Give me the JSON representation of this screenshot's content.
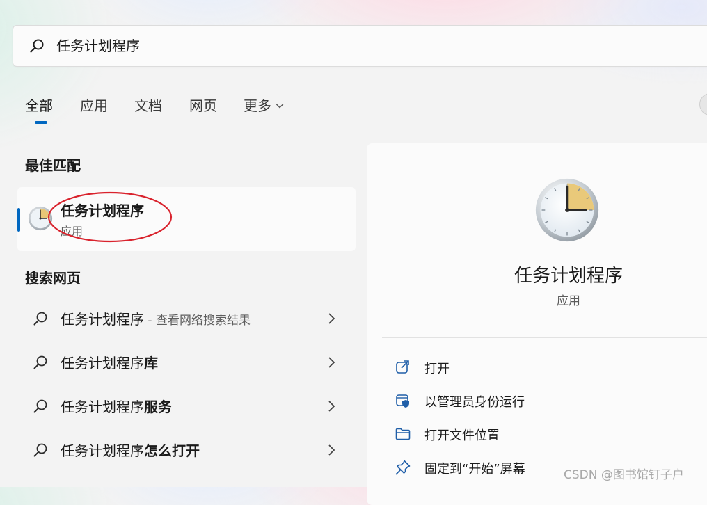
{
  "search": {
    "value": "任务计划程序"
  },
  "tabs": [
    {
      "label": "全部",
      "active": true
    },
    {
      "label": "应用"
    },
    {
      "label": "文档"
    },
    {
      "label": "网页"
    },
    {
      "label": "更多"
    }
  ],
  "best_match": {
    "heading": "最佳匹配",
    "title": "任务计划程序",
    "subtitle": "应用",
    "icon": "task-scheduler-clock-icon"
  },
  "web_search": {
    "heading": "搜索网页",
    "items": [
      {
        "prefix": "任务计划程序",
        "bold": "",
        "hint": " - 查看网络搜索结果"
      },
      {
        "prefix": "任务计划程序",
        "bold": "库",
        "hint": ""
      },
      {
        "prefix": "任务计划程序",
        "bold": "服务",
        "hint": ""
      },
      {
        "prefix": "任务计划程序",
        "bold": "怎么打开",
        "hint": ""
      }
    ]
  },
  "detail": {
    "name": "任务计划程序",
    "type": "应用",
    "actions": [
      {
        "label": "打开",
        "icon": "open-external-icon"
      },
      {
        "label": "以管理员身份运行",
        "icon": "admin-shield-icon"
      },
      {
        "label": "打开文件位置",
        "icon": "folder-icon"
      },
      {
        "label": "固定到“开始”屏幕",
        "icon": "pin-icon"
      }
    ]
  },
  "watermark": "CSDN @图书馆钉子户",
  "colors": {
    "accent": "#0067c0",
    "highlight_ellipse": "#d9232d"
  }
}
